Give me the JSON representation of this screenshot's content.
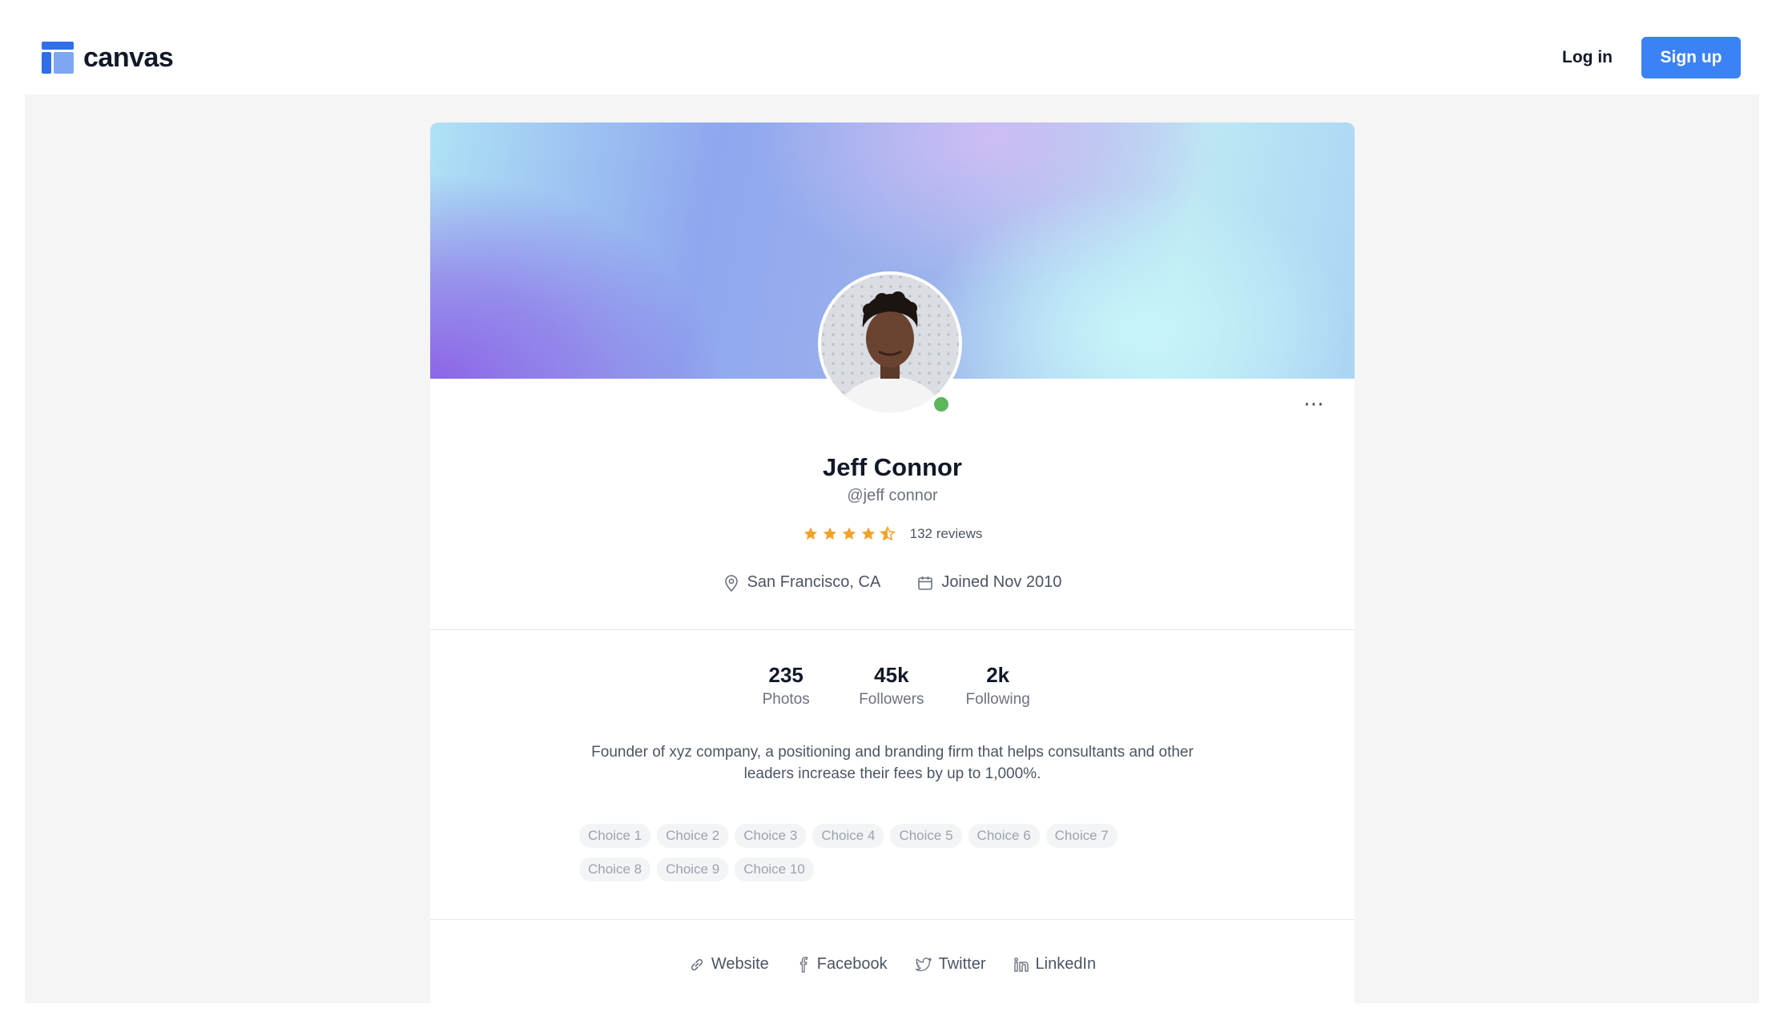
{
  "app": {
    "logo_text": "canvas",
    "logo_icon": "canvas-logo-icon"
  },
  "nav": {
    "login_label": "Log in",
    "signup_label": "Sign up"
  },
  "colors": {
    "accent": "#3b82f6",
    "star": "#f0a32c",
    "online": "#5cb65a"
  },
  "profile": {
    "name": "Jeff Connor",
    "handle": "@jeff connor",
    "online": true,
    "rating": 4.5,
    "reviews": "132 reviews",
    "location": "San Francisco, CA",
    "joined": "Joined Nov 2010",
    "more_icon": "more-horizontal-icon"
  },
  "stats": [
    {
      "value": "235",
      "label": "Photos"
    },
    {
      "value": "45k",
      "label": "Followers"
    },
    {
      "value": "2k",
      "label": "Following"
    }
  ],
  "bio": "Founder of xyz company, a positioning and branding firm that helps consultants and other leaders increase their fees by up to 1,000%.",
  "chips": [
    "Choice 1",
    "Choice 2",
    "Choice 3",
    "Choice 4",
    "Choice 5",
    "Choice 6",
    "Choice 7",
    "Choice 8",
    "Choice 9",
    "Choice 10"
  ],
  "links": [
    {
      "label": "Website",
      "icon": "link-icon"
    },
    {
      "label": "Facebook",
      "icon": "facebook-icon"
    },
    {
      "label": "Twitter",
      "icon": "twitter-icon"
    },
    {
      "label": "LinkedIn",
      "icon": "linkedin-icon"
    }
  ]
}
